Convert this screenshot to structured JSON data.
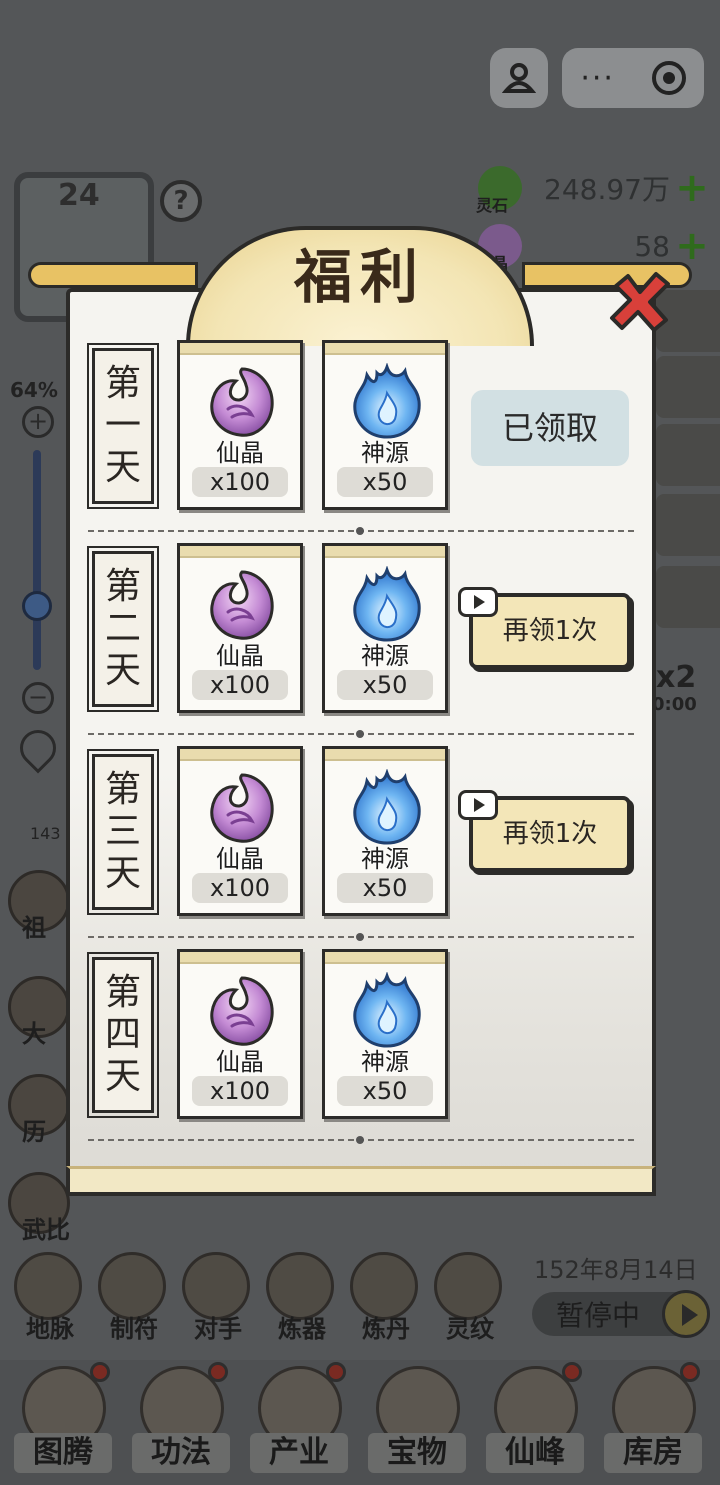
{
  "hud": {
    "level": "24",
    "help": "?",
    "zoom_percent": "64%",
    "zoom_plus": "+",
    "zoom_minus": "−",
    "zoom_level": 0.64,
    "resources": [
      {
        "label": "灵石",
        "value": "248.97万",
        "icon": "spirit-stone-icon",
        "color": "#3b6a2c"
      },
      {
        "label": "仙晶",
        "value": "58",
        "icon": "immortal-crystal-icon",
        "color": "#7b5a8c"
      }
    ]
  },
  "left_menu": [
    {
      "label": "祖",
      "badge": "143"
    },
    {
      "label": "大"
    },
    {
      "label": "历"
    },
    {
      "label": "武比"
    }
  ],
  "right_menu": {
    "multiplier": "x2",
    "timer": "0:00"
  },
  "game_time": {
    "date": "152年8月14日",
    "state": "暂停中"
  },
  "functions": [
    "地脉",
    "制符",
    "对手",
    "炼器",
    "炼丹",
    "灵纹"
  ],
  "bottom_nav": [
    "图腾",
    "功法",
    "产业",
    "宝物",
    "仙峰",
    "库房"
  ],
  "modal": {
    "title": "福利",
    "claimed_label": "已领取",
    "again_label": "再领1次",
    "days": [
      {
        "label": [
          "第",
          "一",
          "天"
        ],
        "status": "claimed",
        "rewards": [
          {
            "name": "仙晶",
            "qty": "x100",
            "icon": "purple-crystal-icon"
          },
          {
            "name": "神源",
            "qty": "x50",
            "icon": "blue-flame-icon"
          }
        ]
      },
      {
        "label": [
          "第",
          "二",
          "天"
        ],
        "status": "again",
        "rewards": [
          {
            "name": "仙晶",
            "qty": "x100",
            "icon": "purple-crystal-icon"
          },
          {
            "name": "神源",
            "qty": "x50",
            "icon": "blue-flame-icon"
          }
        ]
      },
      {
        "label": [
          "第",
          "三",
          "天"
        ],
        "status": "again",
        "rewards": [
          {
            "name": "仙晶",
            "qty": "x100",
            "icon": "purple-crystal-icon"
          },
          {
            "name": "神源",
            "qty": "x50",
            "icon": "blue-flame-icon"
          }
        ]
      },
      {
        "label": [
          "第",
          "四",
          "天"
        ],
        "status": "none",
        "rewards": [
          {
            "name": "仙晶",
            "qty": "x100",
            "icon": "purple-crystal-icon"
          },
          {
            "name": "神源",
            "qty": "x50",
            "icon": "blue-flame-icon"
          }
        ]
      }
    ]
  },
  "colors": {
    "accent_gold": "#e8c264",
    "claimed_bg": "#d2e0e3",
    "again_bg": "#f3e6b8",
    "close_red": "#d8403a"
  }
}
